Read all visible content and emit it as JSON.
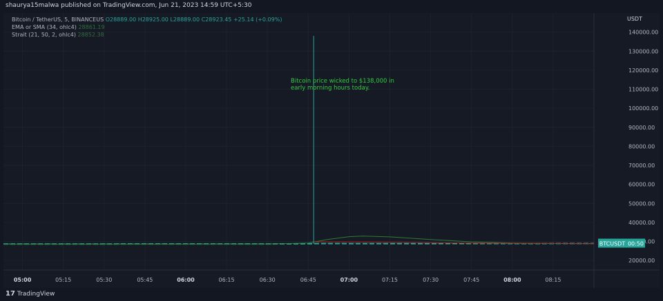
{
  "header": {
    "published_text": "shaurya15malwa published on TradingView.com, Jun 21, 2023 14:59 UTC+5:30"
  },
  "legend": {
    "symbol_line": "Bitcoin / TetherUS, 5, BINANCEUS",
    "open": "O28889.00",
    "high": "H28925.00",
    "low": "L28889.00",
    "close": "C28923.45",
    "change": "+25.14 (+0.09%)",
    "ema_label": "EMA or SMA (34, ohlc4)",
    "ema_value": "28861.19",
    "strait_label": "Strait (21, 50, 2, ohlc4)",
    "strait_value": "28852.38"
  },
  "annotation": {
    "line1": "Bitcoin price wicked to $138,000 in",
    "line2": "early morning hours today."
  },
  "price_tag": {
    "symbol": "BTCUSDT",
    "countdown": "00:50"
  },
  "footer": {
    "brand": "TradingView",
    "logo_glyph": "17"
  },
  "colors": {
    "background": "#161a25",
    "up": "#26a69a",
    "down": "#ef5350",
    "ema": "#2e7d32",
    "strait": "#b71c1c",
    "annotation": "#2ecc40"
  },
  "chart_data": {
    "type": "line",
    "title": "Bitcoin / TetherUS, 5, BINANCEUS",
    "currency_label": "USDT",
    "x_ticks": [
      "05:00",
      "05:15",
      "05:30",
      "05:45",
      "06:00",
      "06:15",
      "06:30",
      "06:45",
      "07:00",
      "07:15",
      "07:30",
      "07:45",
      "08:00",
      "08:15"
    ],
    "x_range": [
      "04:53",
      "08:30"
    ],
    "y_ticks": [
      20000,
      30000,
      40000,
      50000,
      60000,
      70000,
      80000,
      90000,
      100000,
      110000,
      120000,
      130000,
      140000
    ],
    "y_tick_labels": [
      "20000.00",
      "30000.00",
      "40000.00",
      "50000.00",
      "60000.00",
      "70000.00",
      "80000.00",
      "90000.00",
      "100000.00",
      "110000.00",
      "120000.00",
      "130000.00",
      "140000.00"
    ],
    "ylim": [
      15000,
      150000
    ],
    "wick": {
      "time": "06:47",
      "high": 138000
    },
    "series": [
      {
        "name": "BTCUSDT",
        "kind": "price",
        "x": [
          "04:53",
          "05:30",
          "06:00",
          "06:30",
          "06:45",
          "06:50",
          "07:00",
          "07:30",
          "08:00",
          "08:30"
        ],
        "values": [
          28650,
          28680,
          28700,
          28720,
          28780,
          28900,
          28880,
          28870,
          28890,
          28923
        ]
      },
      {
        "name": "EMA or SMA (34, ohlc4)",
        "kind": "ema",
        "x": [
          "04:53",
          "06:30",
          "06:45",
          "06:52",
          "07:00",
          "07:05",
          "07:15",
          "07:30",
          "07:45",
          "08:00",
          "08:30"
        ],
        "values": [
          28600,
          28650,
          29200,
          31000,
          32500,
          32800,
          32400,
          31000,
          29800,
          29200,
          28861
        ]
      },
      {
        "name": "Strait (21, 50, 2, ohlc4)",
        "kind": "strait",
        "x": [
          "06:47",
          "07:00",
          "07:15",
          "07:30",
          "07:45",
          "08:00",
          "08:30"
        ],
        "values": [
          29800,
          29700,
          29600,
          29400,
          29200,
          29000,
          28852
        ]
      }
    ],
    "last_price": 28923.45,
    "grid": true
  }
}
